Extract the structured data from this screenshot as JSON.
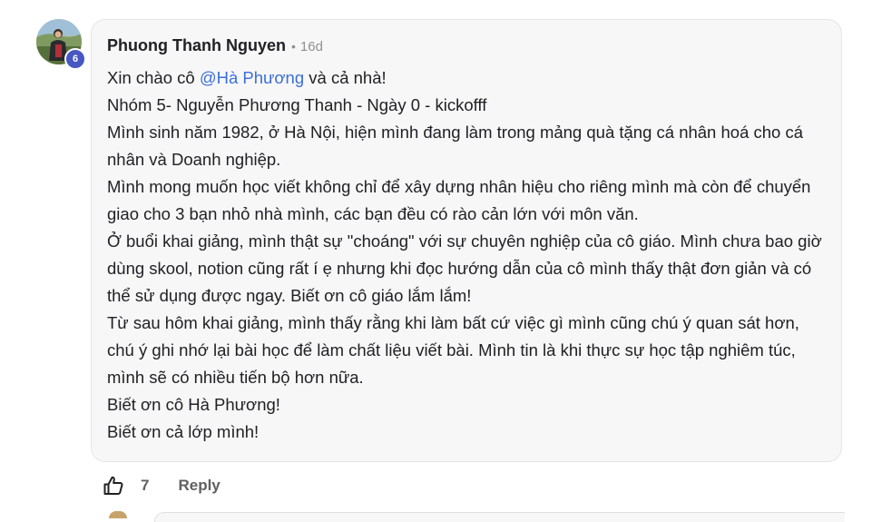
{
  "comment": {
    "author": "Phuong Thanh Nguyen",
    "separator": "•",
    "timestamp": "16d",
    "level_badge": "6",
    "avatar_icon": "user-avatar-photo",
    "lines": {
      "greeting_prefix": "Xin chào cô ",
      "mention": "@Hà Phương",
      "greeting_suffix": " và cả nhà!",
      "line2": "Nhóm 5- Nguyễn Phương Thanh - Ngày 0 - kickofff",
      "line3": "Mình sinh năm 1982, ở Hà Nội, hiện mình đang làm trong mảng quà tặng cá nhân hoá cho cá nhân và Doanh nghiệp.",
      "line4": "Mình mong muốn học viết không chỉ để xây dựng nhân hiệu cho riêng mình mà còn để chuyển giao cho 3 bạn nhỏ nhà mình, các bạn đều có rào cản lớn với môn văn.",
      "line5": "Ở buổi khai giảng, mình thật sự \"choáng\" với sự chuyên nghiệp của cô giáo. Mình chưa bao giờ dùng skool, notion cũng rất í ẹ nhưng khi đọc hướng dẫn của cô mình thấy thật đơn giản và có thể sử dụng được ngay. Biết ơn cô giáo lắm lắm!",
      "line6": "Từ sau hôm khai giảng, mình thấy rằng khi làm bất cứ việc gì mình cũng chú ý quan sát hơn, chú ý ghi nhớ lại bài học để làm chất liệu viết bài. Mình tin là khi thực sự học tập nghiêm túc, mình sẽ có nhiều tiến bộ hơn nữa.",
      "line7": "Biết ơn cô Hà Phương!",
      "line8": "Biết ơn cả lớp mình!"
    },
    "actions": {
      "like_icon": "thumbs-up-icon",
      "like_count": "7",
      "reply_label": "Reply"
    }
  },
  "colors": {
    "mention": "#3b6fd8",
    "badge": "#4757c3",
    "bubble_bg": "#f7f7f8",
    "muted_text": "#606060"
  }
}
